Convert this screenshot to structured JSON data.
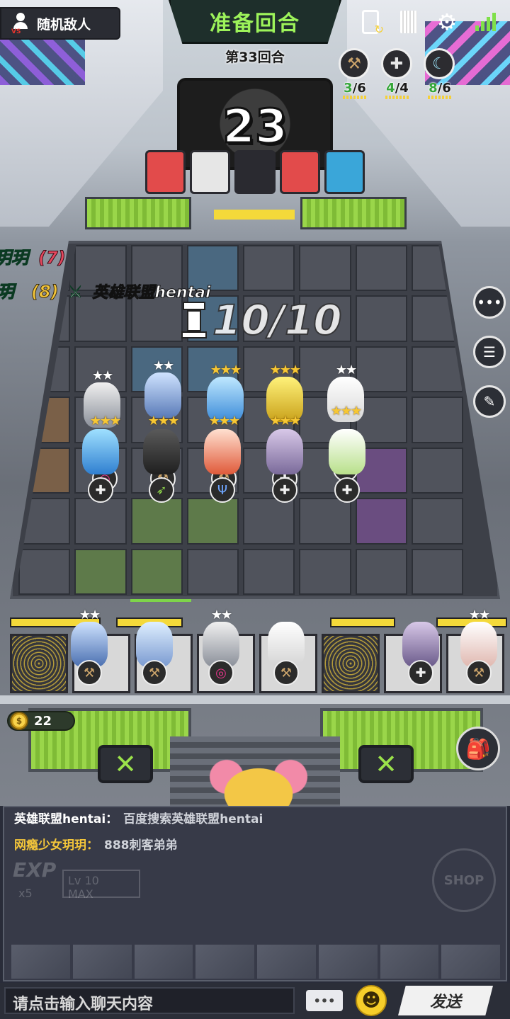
{
  "header": {
    "mode_label": "随机敌人",
    "phase_title": "准备回合",
    "round_label": "第33回合",
    "timer": "23"
  },
  "traits": [
    {
      "icon": "hammer-icon",
      "active": "3",
      "sep": "/",
      "total": "6"
    },
    {
      "icon": "cross-icon",
      "active": "4",
      "sep": "/",
      "total": "4"
    },
    {
      "icon": "moon-icon",
      "active": "8",
      "sep": "/",
      "total": "6"
    }
  ],
  "opponents": {
    "line1_name": "玥玥",
    "line1_level": "(7)",
    "line2_name": "玥",
    "line2_level": "(8)",
    "line2_vs_icon": "crossed-swords-icon",
    "line2_opponent": "英雄联盟hentai"
  },
  "population": {
    "text": "10/10"
  },
  "board_units": [
    {
      "stars": "★★",
      "star_color": "silver",
      "badge": "cross-icon"
    },
    {
      "stars": "★★",
      "star_color": "silver",
      "badge": "bow-icon"
    },
    {
      "stars": "★★★",
      "star_color": "gold",
      "badge": "trident-icon"
    },
    {
      "stars": "★★★",
      "star_color": "gold",
      "badge": "cross-icon"
    },
    {
      "stars": "★★",
      "star_color": "silver",
      "badge": "cross-icon"
    },
    {
      "stars": "★★★",
      "star_color": "gold",
      "badge": "target-icon"
    },
    {
      "stars": "★★★",
      "star_color": "gold",
      "badge": "hammer-icon"
    },
    {
      "stars": "★★★",
      "star_color": "gold",
      "badge": "hammer-icon"
    },
    {
      "stars": "★★★",
      "star_color": "gold",
      "badge": "cross-icon"
    },
    {
      "stars": "★★★",
      "star_color": "gold",
      "badge": "hammer-icon"
    }
  ],
  "bench_units": [
    {
      "stars": "★★",
      "badge": "hammer-icon"
    },
    {
      "stars": "",
      "badge": "hammer-icon"
    },
    {
      "stars": "★★",
      "badge": "target-icon"
    },
    {
      "stars": "",
      "badge": "hammer-icon"
    },
    {
      "stars": "",
      "badge": "cross-icon"
    },
    {
      "stars": "★★",
      "badge": "hammer-icon"
    }
  ],
  "gold": {
    "amount": "22"
  },
  "side_buttons": [
    "chat-bubble-icon",
    "player-list-icon",
    "sword-note-icon"
  ],
  "chat": {
    "messages": [
      {
        "speaker": "英雄联盟hentai：",
        "content": "百度搜索英雄联盟hentai"
      },
      {
        "speaker": "网瘾少女玥玥：",
        "content": "888刺客弟弟"
      }
    ],
    "input_placeholder": "请点击输入聊天内容",
    "send_label": "发送"
  },
  "ghost_ui": {
    "exp_label": "EXP",
    "exp_cost": "x5",
    "level_label": "Lv 10",
    "level_max": "MAX",
    "shop_label": "SHOP"
  },
  "colors": {
    "phase_text": "#9df35a",
    "trait_active": "#35a63a",
    "star_gold": "#f7c733",
    "bench_bar": "#f4d93a"
  }
}
